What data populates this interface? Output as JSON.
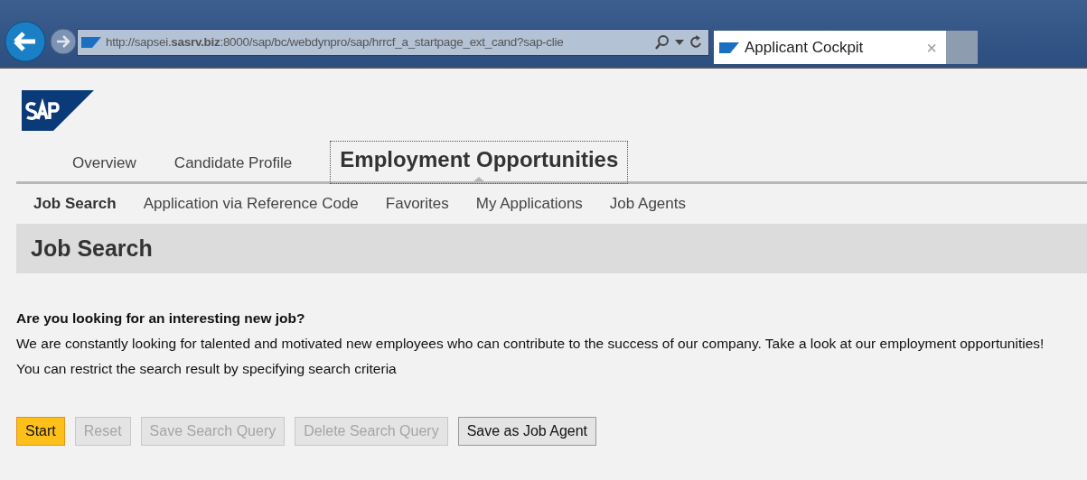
{
  "browser": {
    "address": "http://sapsei.**sasrv.biz**:8000/sap/bc/webdynpro/sap/hrrcf_a_startpage_ext_cand?sap-clie",
    "tab_title": "Applicant Cockpit",
    "tab_close": "×"
  },
  "tabs": [
    {
      "label": "Overview",
      "selected": false
    },
    {
      "label": "Candidate Profile",
      "selected": false
    },
    {
      "label": "Employment Opportunities",
      "selected": true
    }
  ],
  "subtabs": [
    {
      "label": "Job Search",
      "selected": true
    },
    {
      "label": "Application via Reference Code",
      "selected": false
    },
    {
      "label": "Favorites",
      "selected": false
    },
    {
      "label": "My Applications",
      "selected": false
    },
    {
      "label": "Job Agents",
      "selected": false
    }
  ],
  "page_title": "Job Search",
  "intro": {
    "heading": "Are you looking for an interesting new job?",
    "lines": [
      "We are constantly looking for talented and motivated new employees who can contribute to the success of our company. Take a look at our employment opportunities!",
      "You can restrict the search result by specifying search criteria"
    ]
  },
  "buttons": [
    {
      "label": "Start",
      "emphasized": true,
      "disabled": false
    },
    {
      "label": "Reset",
      "emphasized": false,
      "disabled": true
    },
    {
      "label": "Save Search Query",
      "emphasized": false,
      "disabled": true
    },
    {
      "label": "Delete Search Query",
      "emphasized": false,
      "disabled": true
    },
    {
      "label": "Save as Job Agent",
      "emphasized": false,
      "disabled": false
    }
  ]
}
